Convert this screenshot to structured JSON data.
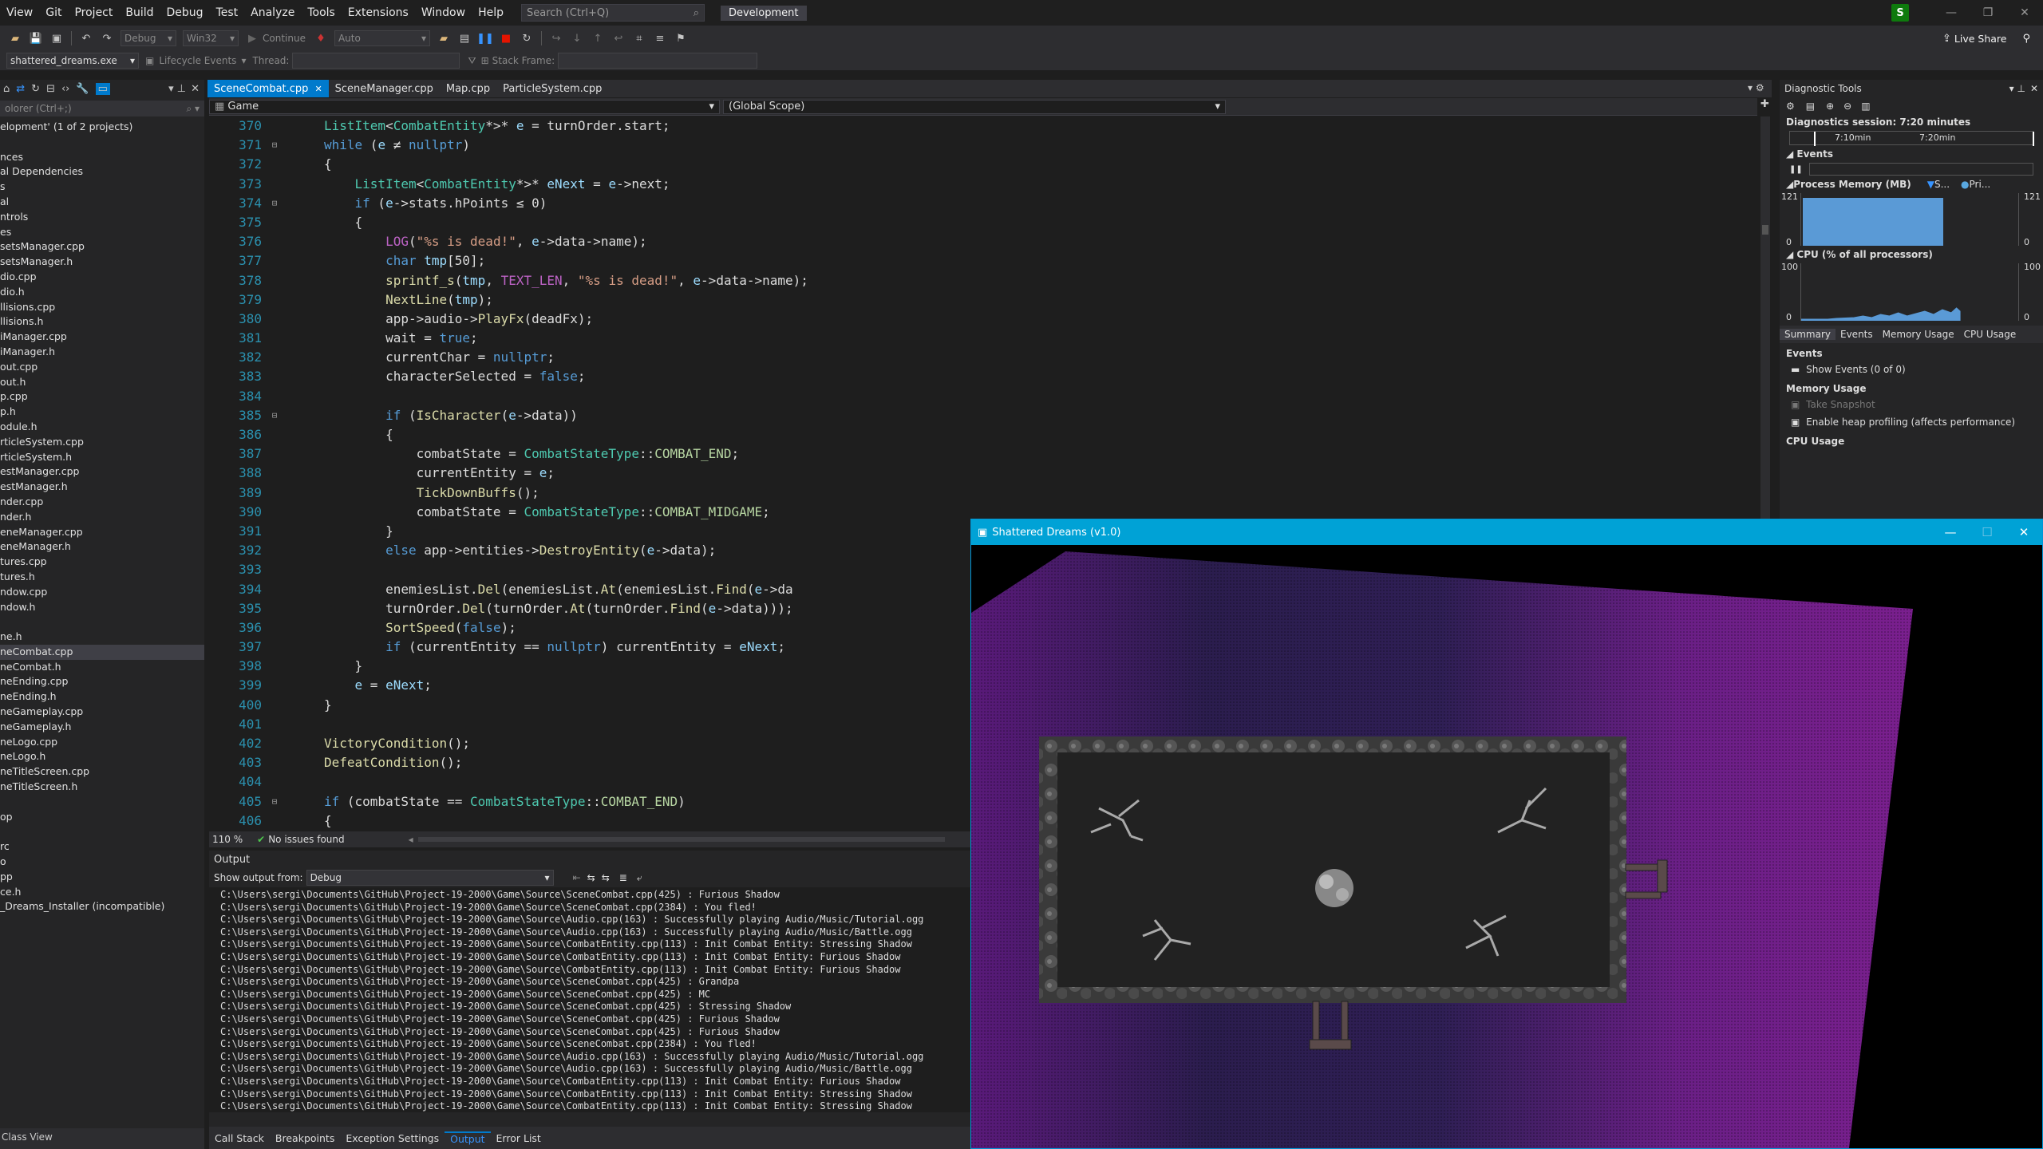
{
  "menu": [
    "View",
    "Git",
    "Project",
    "Build",
    "Debug",
    "Test",
    "Analyze",
    "Tools",
    "Extensions",
    "Window",
    "Help"
  ],
  "search": {
    "placeholder": "Search (Ctrl+Q)"
  },
  "config_badge": "Development",
  "user_initial": "S",
  "live_share": "Live Share",
  "toolbar": {
    "config": "Debug",
    "platform": "Win32",
    "continue": "Continue",
    "auto": "Auto"
  },
  "toolbar2": {
    "process": "shattered_dreams.exe",
    "lifecycle": "Lifecycle Events",
    "thread": "Thread:",
    "stack_frame": "Stack Frame:"
  },
  "solution": {
    "search": "olorer (Ctrl+;)",
    "root": "elopment' (1 of 2 projects)",
    "items": [
      "",
      "nces",
      "al Dependencies",
      "s",
      "al",
      "ntrols",
      "es",
      "setsManager.cpp",
      "setsManager.h",
      "dio.cpp",
      "dio.h",
      "llisions.cpp",
      "llisions.h",
      "iManager.cpp",
      "iManager.h",
      "out.cpp",
      "out.h",
      "p.cpp",
      "p.h",
      "odule.h",
      "rticleSystem.cpp",
      "rticleSystem.h",
      "estManager.cpp",
      "estManager.h",
      "nder.cpp",
      "nder.h",
      "eneManager.cpp",
      "eneManager.h",
      "tures.cpp",
      "tures.h",
      "ndow.cpp",
      "ndow.h",
      "",
      "ne.h",
      "neCombat.cpp",
      "neCombat.h",
      "neEnding.cpp",
      "neEnding.h",
      "neGameplay.cpp",
      "neGameplay.h",
      "neLogo.cpp",
      "neLogo.h",
      "neTitleScreen.cpp",
      "neTitleScreen.h",
      "",
      "op",
      "",
      "rc",
      "o",
      "pp",
      "ce.h",
      "_Dreams_Installer (incompatible)"
    ],
    "selected_index": 34,
    "class_view": "Class View"
  },
  "editor": {
    "tabs": [
      "SceneCombat.cpp",
      "SceneManager.cpp",
      "Map.cpp",
      "ParticleSystem.cpp"
    ],
    "scope_left": "Game",
    "scope_right": "(Global Scope)",
    "zoom": "110 %",
    "issues": "No issues found"
  },
  "code_lines": [
    {
      "n": "370",
      "fold": "",
      "html": "<span class='ty'>ListItem</span>&lt;<span class='ty'>CombatEntity</span>*&gt;* <span class='vr'>e</span> = turnOrder.start;"
    },
    {
      "n": "371",
      "fold": "⊟",
      "html": "<span class='kw'>while</span> (<span class='vr'>e</span> ≠ <span class='kw'>nullptr</span>)"
    },
    {
      "n": "372",
      "fold": "",
      "html": "{"
    },
    {
      "n": "373",
      "fold": "",
      "html": "    <span class='ty'>ListItem</span>&lt;<span class='ty'>CombatEntity</span>*&gt;* <span class='vr'>eNext</span> = <span class='vr'>e</span>-&gt;next;"
    },
    {
      "n": "374",
      "fold": "⊟",
      "html": "    <span class='kw'>if</span> (<span class='vr'>e</span>-&gt;stats.hPoints ≤ 0)"
    },
    {
      "n": "375",
      "fold": "",
      "html": "    {"
    },
    {
      "n": "376",
      "fold": "",
      "html": "        <span class='mc'>LOG</span>(<span class='st'>\"%s is dead!\"</span>, <span class='vr'>e</span>-&gt;data-&gt;name);"
    },
    {
      "n": "377",
      "fold": "",
      "html": "        <span class='kw'>char</span> <span class='vr'>tmp</span>[50];"
    },
    {
      "n": "378",
      "fold": "",
      "html": "        <span class='fn'>sprintf_s</span>(<span class='vr'>tmp</span>, <span class='mc'>TEXT_LEN</span>, <span class='st'>\"%s is dead!\"</span>, <span class='vr'>e</span>-&gt;data-&gt;name);"
    },
    {
      "n": "379",
      "fold": "",
      "html": "        <span class='fn'>NextLine</span>(<span class='vr'>tmp</span>);"
    },
    {
      "n": "380",
      "fold": "",
      "html": "        app-&gt;audio-&gt;<span class='fn'>PlayFx</span>(deadFx);"
    },
    {
      "n": "381",
      "fold": "",
      "html": "        wait = <span class='kw'>true</span>;"
    },
    {
      "n": "382",
      "fold": "",
      "html": "        currentChar = <span class='kw'>nullptr</span>;"
    },
    {
      "n": "383",
      "fold": "",
      "html": "        characterSelected = <span class='kw'>false</span>;"
    },
    {
      "n": "384",
      "fold": "",
      "html": ""
    },
    {
      "n": "385",
      "fold": "⊟",
      "html": "        <span class='kw'>if</span> (<span class='fn'>IsCharacter</span>(<span class='vr'>e</span>-&gt;data))"
    },
    {
      "n": "386",
      "fold": "",
      "html": "        {"
    },
    {
      "n": "387",
      "fold": "",
      "html": "            combatState = <span class='ty'>CombatStateType</span>::<span class='en'>COMBAT_END</span>;"
    },
    {
      "n": "388",
      "fold": "",
      "html": "            currentEntity = <span class='vr'>e</span>;"
    },
    {
      "n": "389",
      "fold": "",
      "html": "            <span class='fn'>TickDownBuffs</span>();"
    },
    {
      "n": "390",
      "fold": "",
      "html": "            combatState = <span class='ty'>CombatStateType</span>::<span class='en'>COMBAT_MIDGAME</span>;"
    },
    {
      "n": "391",
      "fold": "",
      "html": "        }"
    },
    {
      "n": "392",
      "fold": "",
      "html": "        <span class='kw'>else</span> app-&gt;entities-&gt;<span class='fn'>DestroyEntity</span>(<span class='vr'>e</span>-&gt;data);"
    },
    {
      "n": "393",
      "fold": "",
      "html": ""
    },
    {
      "n": "394",
      "fold": "",
      "html": "        enemiesList.<span class='fn'>Del</span>(enemiesList.<span class='fn'>At</span>(enemiesList.<span class='fn'>Find</span>(<span class='vr'>e</span>-&gt;da"
    },
    {
      "n": "395",
      "fold": "",
      "html": "        turnOrder.<span class='fn'>Del</span>(turnOrder.<span class='fn'>At</span>(turnOrder.<span class='fn'>Find</span>(<span class='vr'>e</span>-&gt;data)));"
    },
    {
      "n": "396",
      "fold": "",
      "html": "        <span class='fn'>SortSpeed</span>(<span class='kw'>false</span>);"
    },
    {
      "n": "397",
      "fold": "",
      "html": "        <span class='kw'>if</span> (currentEntity == <span class='kw'>nullptr</span>) currentEntity = <span class='vr'>eNext</span>;"
    },
    {
      "n": "398",
      "fold": "",
      "html": "    }"
    },
    {
      "n": "399",
      "fold": "",
      "html": "    <span class='vr'>e</span> = <span class='vr'>eNext</span>;"
    },
    {
      "n": "400",
      "fold": "",
      "html": "}"
    },
    {
      "n": "401",
      "fold": "",
      "html": ""
    },
    {
      "n": "402",
      "fold": "",
      "html": "<span class='fn'>VictoryCondition</span>();"
    },
    {
      "n": "403",
      "fold": "",
      "html": "<span class='fn'>DefeatCondition</span>();"
    },
    {
      "n": "404",
      "fold": "",
      "html": ""
    },
    {
      "n": "405",
      "fold": "⊟",
      "html": "<span class='kw'>if</span> (combatState == <span class='ty'>CombatStateType</span>::<span class='en'>COMBAT_END</span>)"
    },
    {
      "n": "406",
      "fold": "",
      "html": "{"
    }
  ],
  "output": {
    "title": "Output",
    "show_from_label": "Show output from:",
    "show_from_value": "Debug",
    "lines": [
      "C:\\Users\\sergi\\Documents\\GitHub\\Project-19-2000\\Game\\Source\\SceneCombat.cpp(425) : Furious Shadow",
      "C:\\Users\\sergi\\Documents\\GitHub\\Project-19-2000\\Game\\Source\\SceneCombat.cpp(2384) : You fled!",
      "C:\\Users\\sergi\\Documents\\GitHub\\Project-19-2000\\Game\\Source\\Audio.cpp(163) : Successfully playing Audio/Music/Tutorial.ogg",
      "C:\\Users\\sergi\\Documents\\GitHub\\Project-19-2000\\Game\\Source\\Audio.cpp(163) : Successfully playing Audio/Music/Battle.ogg",
      "C:\\Users\\sergi\\Documents\\GitHub\\Project-19-2000\\Game\\Source\\CombatEntity.cpp(113) : Init Combat Entity: Stressing Shadow",
      "C:\\Users\\sergi\\Documents\\GitHub\\Project-19-2000\\Game\\Source\\CombatEntity.cpp(113) : Init Combat Entity: Furious Shadow",
      "C:\\Users\\sergi\\Documents\\GitHub\\Project-19-2000\\Game\\Source\\CombatEntity.cpp(113) : Init Combat Entity: Furious Shadow",
      "C:\\Users\\sergi\\Documents\\GitHub\\Project-19-2000\\Game\\Source\\SceneCombat.cpp(425) : Grandpa",
      "C:\\Users\\sergi\\Documents\\GitHub\\Project-19-2000\\Game\\Source\\SceneCombat.cpp(425) : MC",
      "C:\\Users\\sergi\\Documents\\GitHub\\Project-19-2000\\Game\\Source\\SceneCombat.cpp(425) : Stressing Shadow",
      "C:\\Users\\sergi\\Documents\\GitHub\\Project-19-2000\\Game\\Source\\SceneCombat.cpp(425) : Furious Shadow",
      "C:\\Users\\sergi\\Documents\\GitHub\\Project-19-2000\\Game\\Source\\SceneCombat.cpp(425) : Furious Shadow",
      "C:\\Users\\sergi\\Documents\\GitHub\\Project-19-2000\\Game\\Source\\SceneCombat.cpp(2384) : You fled!",
      "C:\\Users\\sergi\\Documents\\GitHub\\Project-19-2000\\Game\\Source\\Audio.cpp(163) : Successfully playing Audio/Music/Tutorial.ogg",
      "C:\\Users\\sergi\\Documents\\GitHub\\Project-19-2000\\Game\\Source\\Audio.cpp(163) : Successfully playing Audio/Music/Battle.ogg",
      "C:\\Users\\sergi\\Documents\\GitHub\\Project-19-2000\\Game\\Source\\CombatEntity.cpp(113) : Init Combat Entity: Furious Shadow",
      "C:\\Users\\sergi\\Documents\\GitHub\\Project-19-2000\\Game\\Source\\CombatEntity.cpp(113) : Init Combat Entity: Stressing Shadow",
      "C:\\Users\\sergi\\Documents\\GitHub\\Project-19-2000\\Game\\Source\\CombatEntity.cpp(113) : Init Combat Entity: Stressing Shadow"
    ]
  },
  "bottom_tabs": [
    "Call Stack",
    "Breakpoints",
    "Exception Settings",
    "Output",
    "Error List"
  ],
  "bottom_active": "Output",
  "diagnostics": {
    "title": "Diagnostic Tools",
    "session": "Diagnostics session: 7:20 minutes",
    "time_a": "7:10min",
    "time_b": "7:20min",
    "events": "Events",
    "process_memory": "Process Memory (MB)",
    "mem_legend_a": "S...",
    "mem_legend_b": "Pri...",
    "mem_max": "121",
    "mem_min": "0",
    "cpu": "CPU (% of all processors)",
    "cpu_max": "100",
    "cpu_min": "0",
    "tabs": [
      "Summary",
      "Events",
      "Memory Usage",
      "CPU Usage"
    ],
    "events_header": "Events",
    "show_events": "Show Events (0 of 0)",
    "memory_header": "Memory Usage",
    "take_snapshot": "Take Snapshot",
    "heap_profiling": "Enable heap profiling (affects performance)",
    "cpu_header": "CPU Usage"
  },
  "game": {
    "title": "Shattered Dreams (v1.0)"
  }
}
